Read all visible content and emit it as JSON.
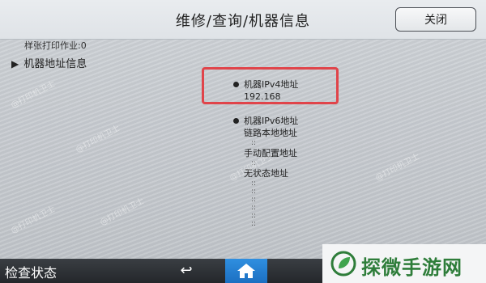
{
  "window": {
    "title": "维修/查询/机器信息",
    "close_label": "关闭"
  },
  "content": {
    "sample_print_line": "样张打印作业:0",
    "section_title": "机器地址信息",
    "ipv4": {
      "label": "机器IPv4地址",
      "value": "192.168"
    },
    "ipv6": {
      "label": "机器IPv6地址",
      "link_local_label": "链路本地地址",
      "manual_label": "手动配置地址",
      "stateless_label": "无状态地址"
    },
    "colon": "::"
  },
  "bottombar": {
    "status_label": "检查状态",
    "back_icon": "back-arrow-icon",
    "home_icon": "home-icon"
  },
  "watermarks": {
    "text": "@打印机卫士"
  },
  "brand": {
    "text": "探微手游网",
    "logo_color": "#2e7d3a"
  },
  "colors": {
    "highlight": "#e0444a",
    "home_button": "#1f78d1"
  }
}
